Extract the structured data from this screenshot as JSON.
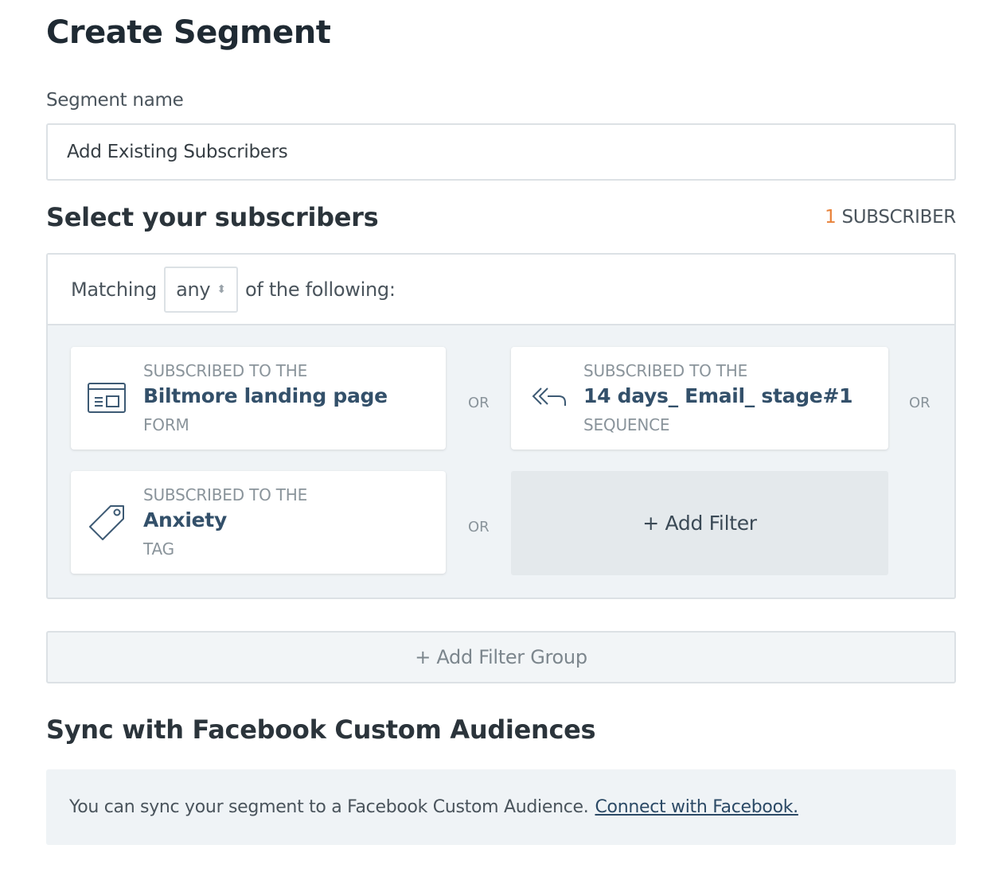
{
  "page": {
    "title": "Create Segment"
  },
  "segment_name": {
    "label": "Segment name",
    "value": "Add Existing Subscribers"
  },
  "select": {
    "title": "Select your subscribers",
    "count_number": "1",
    "count_label": "SUBSCRIBER"
  },
  "matching": {
    "prefix": "Matching",
    "value": "any",
    "suffix": "of the following:"
  },
  "filters": [
    {
      "kicker": "SUBSCRIBED TO THE",
      "name": "Biltmore landing page",
      "kind": "FORM",
      "icon": "form-icon"
    },
    {
      "kicker": "SUBSCRIBED TO THE",
      "name": "14 days_ Email_ stage#1",
      "kind": "SEQUENCE",
      "icon": "sequence-icon"
    },
    {
      "kicker": "SUBSCRIBED TO THE",
      "name": "Anxiety",
      "kind": "TAG",
      "icon": "tag-icon"
    }
  ],
  "or_label": "OR",
  "add_filter_label": "+ Add Filter",
  "add_filter_group_label": "+ Add Filter Group",
  "sync": {
    "title": "Sync with Facebook Custom Audiences",
    "text": "You can sync your segment to a Facebook Custom Audience.",
    "link": "Connect with Facebook."
  },
  "colors": {
    "accent_orange": "#e8823a",
    "link_blue": "#2c4a66",
    "panel_bg": "#eff3f6"
  }
}
